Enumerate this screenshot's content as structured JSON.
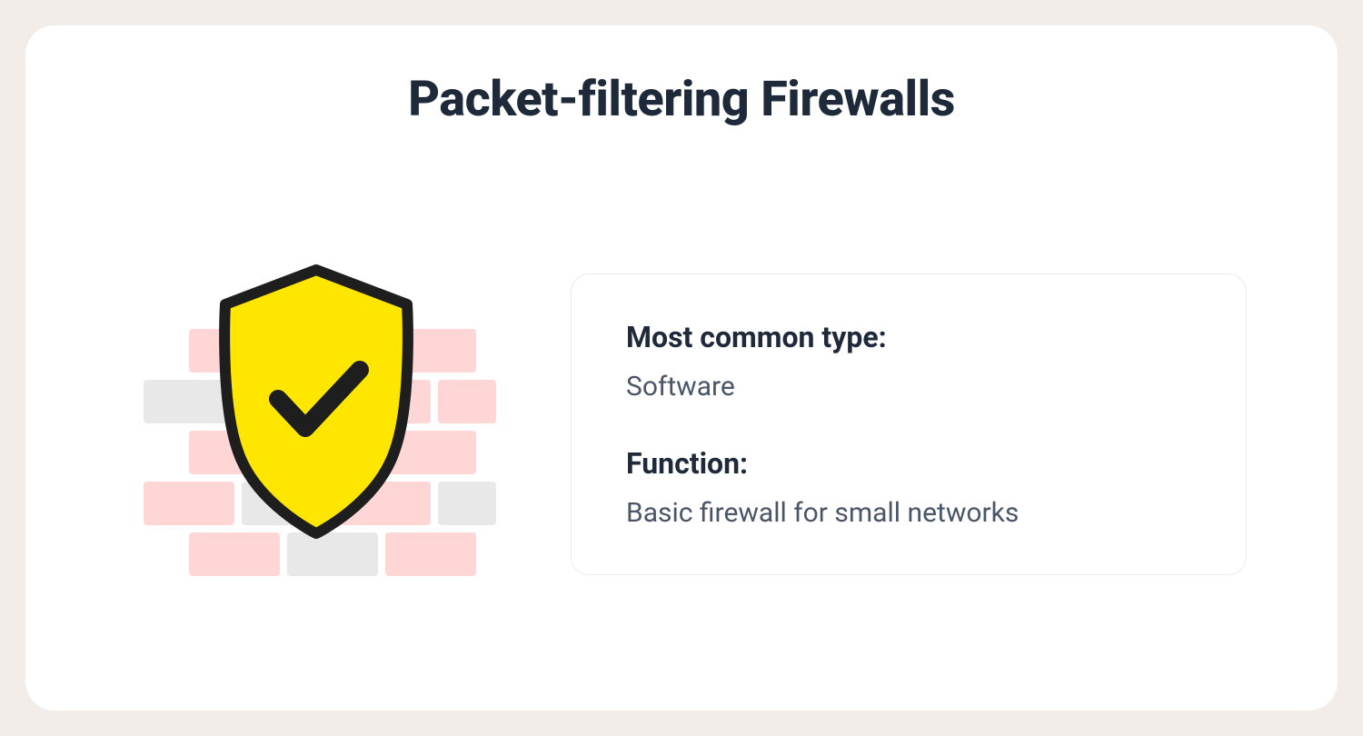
{
  "card": {
    "title": "Packet-filtering Firewalls",
    "icon": "firewall-shield-check",
    "info": {
      "label1": "Most common type:",
      "value1": "Software",
      "label2": "Function:",
      "value2": "Basic firewall for small networks"
    },
    "colors": {
      "shield_fill": "#ffe600",
      "shield_stroke": "#1e1e1e",
      "brick_pink": "#ffd6d6",
      "brick_gray": "#e8e8e8",
      "text_dark": "#1e2a3a",
      "text_body": "#4a5568"
    }
  }
}
